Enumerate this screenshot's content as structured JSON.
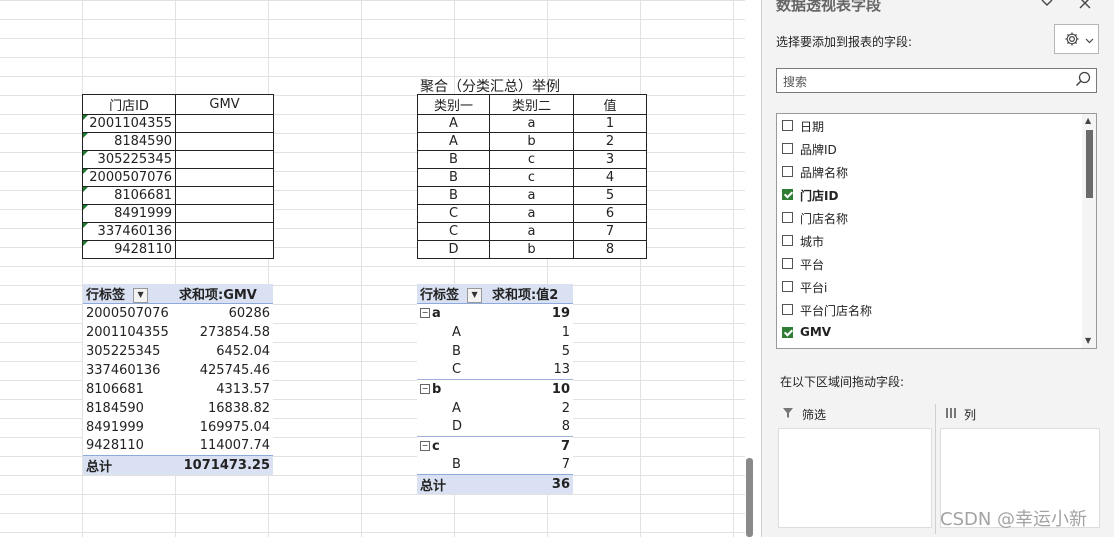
{
  "table_store": {
    "headers": [
      "门店ID",
      "GMV"
    ],
    "rows": [
      "2001104355",
      "8184590",
      "305225345",
      "2000507076",
      "8106681",
      "8491999",
      "337460136",
      "9428110"
    ]
  },
  "example_caption": "聚合（分类汇总）举例",
  "table_example": {
    "headers": [
      "类别一",
      "类别二",
      "值"
    ],
    "rows": [
      [
        "A",
        "a",
        "1"
      ],
      [
        "A",
        "b",
        "2"
      ],
      [
        "B",
        "c",
        "3"
      ],
      [
        "B",
        "c",
        "4"
      ],
      [
        "B",
        "a",
        "5"
      ],
      [
        "C",
        "a",
        "6"
      ],
      [
        "C",
        "a",
        "7"
      ],
      [
        "D",
        "b",
        "8"
      ]
    ]
  },
  "pivot_store": {
    "row_label": "行标签",
    "value_label": "求和项:GMV",
    "rows": [
      [
        "2000507076",
        "60286"
      ],
      [
        "2001104355",
        "273854.58"
      ],
      [
        "305225345",
        "6452.04"
      ],
      [
        "337460136",
        "425745.46"
      ],
      [
        "8106681",
        "4313.57"
      ],
      [
        "8184590",
        "16838.82"
      ],
      [
        "8491999",
        "169975.04"
      ],
      [
        "9428110",
        "114007.74"
      ]
    ],
    "total_label": "总计",
    "total_value": "1071473.25"
  },
  "pivot_example": {
    "row_label": "行标签",
    "value_label": "求和项:值2",
    "groups": [
      {
        "name": "a",
        "total": "19",
        "items": [
          [
            "A",
            "1"
          ],
          [
            "B",
            "5"
          ],
          [
            "C",
            "13"
          ]
        ]
      },
      {
        "name": "b",
        "total": "10",
        "items": [
          [
            "A",
            "2"
          ],
          [
            "D",
            "8"
          ]
        ]
      },
      {
        "name": "c",
        "total": "7",
        "items": [
          [
            "B",
            "7"
          ]
        ]
      }
    ],
    "total_label": "总计",
    "total_value": "36"
  },
  "pane": {
    "title": "数据透视表字段",
    "choose_label": "选择要添加到报表的字段:",
    "search_placeholder": "搜索",
    "fields": [
      {
        "label": "日期",
        "checked": false
      },
      {
        "label": "品牌ID",
        "checked": false
      },
      {
        "label": "品牌名称",
        "checked": false
      },
      {
        "label": "门店ID",
        "checked": true
      },
      {
        "label": "门店名称",
        "checked": false
      },
      {
        "label": "城市",
        "checked": false
      },
      {
        "label": "平台",
        "checked": false
      },
      {
        "label": "平台i",
        "checked": false
      },
      {
        "label": "平台门店名称",
        "checked": false
      },
      {
        "label": "GMV",
        "checked": true
      }
    ],
    "drag_label": "在以下区域间拖动字段:",
    "filter_label": "筛选",
    "columns_label": "列"
  },
  "watermark": "CSDN @幸运小新",
  "icons": [
    "chevron-down-icon",
    "close-icon",
    "gear-icon",
    "search-icon",
    "filter-icon",
    "columns-icon"
  ]
}
